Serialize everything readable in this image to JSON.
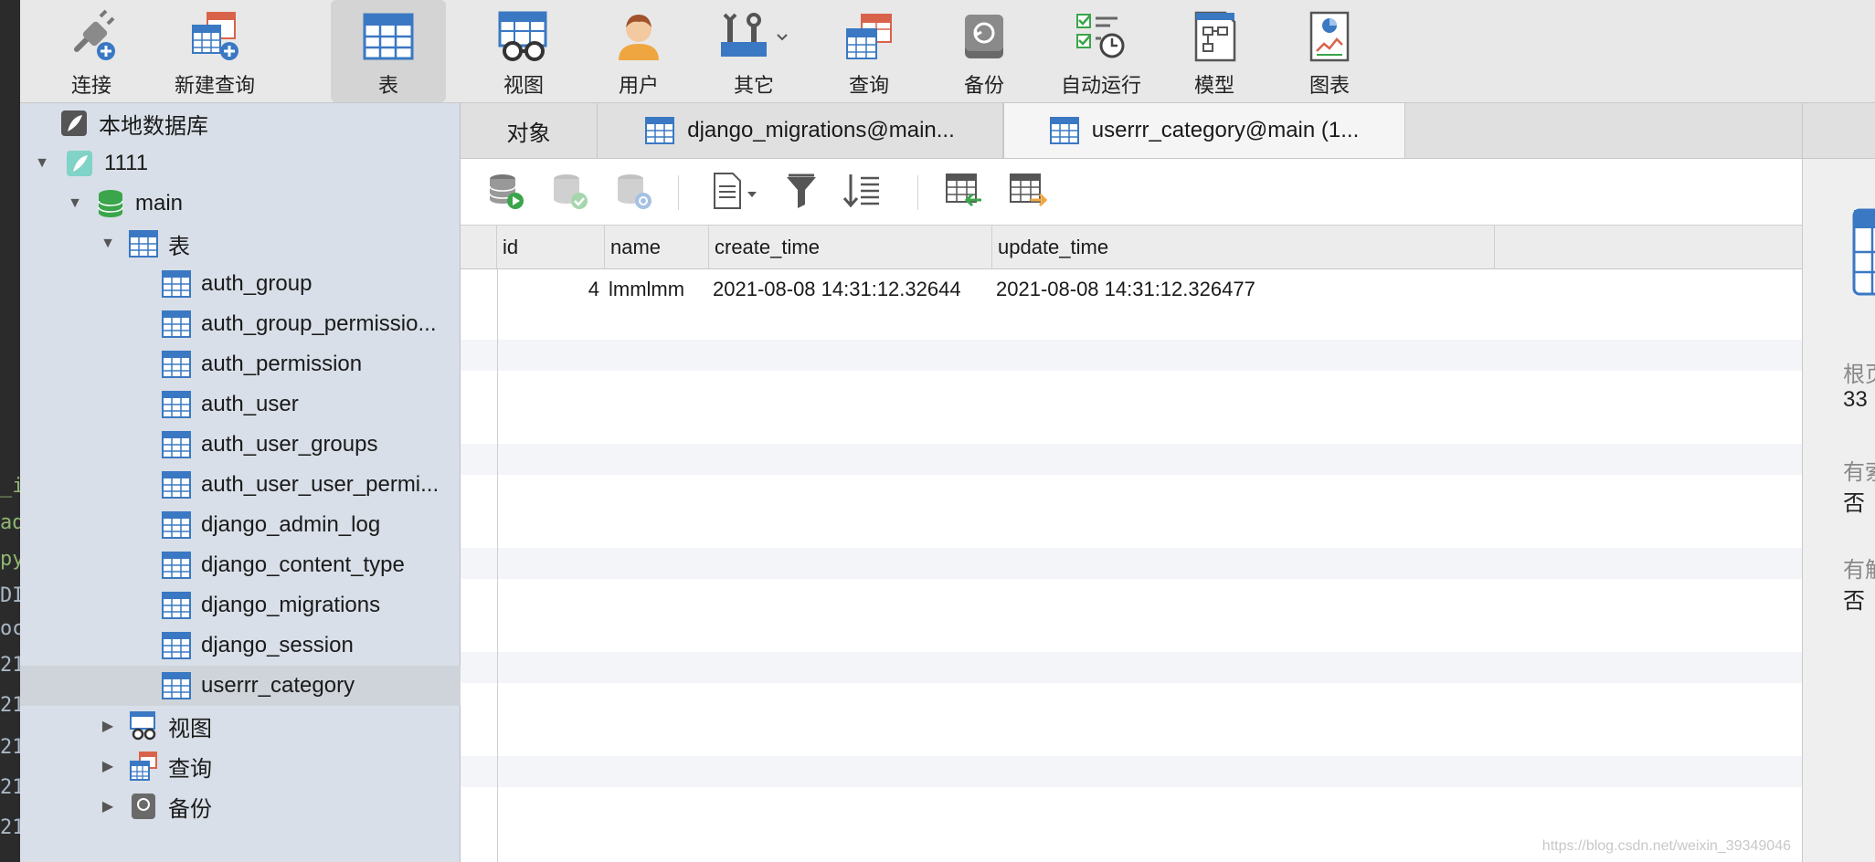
{
  "toolbar": {
    "items": [
      {
        "label": "连接",
        "icon": "plug-icon"
      },
      {
        "label": "新建查询",
        "icon": "new-query-icon"
      },
      {
        "label": "表",
        "icon": "table-icon",
        "active": true
      },
      {
        "label": "视图",
        "icon": "view-icon"
      },
      {
        "label": "用户",
        "icon": "user-icon"
      },
      {
        "label": "其它",
        "icon": "tools-icon"
      },
      {
        "label": "查询",
        "icon": "query-icon"
      },
      {
        "label": "备份",
        "icon": "backup-icon"
      },
      {
        "label": "自动运行",
        "icon": "automation-icon"
      },
      {
        "label": "模型",
        "icon": "model-icon"
      },
      {
        "label": "图表",
        "icon": "chart-icon"
      }
    ]
  },
  "sidebar": {
    "local_db": "本地数据库",
    "connection": "1111",
    "schema": "main",
    "tables_folder": "表",
    "tables": [
      "auth_group",
      "auth_group_permissio...",
      "auth_permission",
      "auth_user",
      "auth_user_groups",
      "auth_user_user_permi...",
      "django_admin_log",
      "django_content_type",
      "django_migrations",
      "django_session",
      "userrr_category"
    ],
    "selected_table": "userrr_category",
    "views_folder": "视图",
    "queries_folder": "查询",
    "backups_folder": "备份"
  },
  "tabs": [
    {
      "label": "对象"
    },
    {
      "label": "django_migrations@main..."
    },
    {
      "label": "userrr_category@main (1..."
    }
  ],
  "grid": {
    "columns": [
      "id",
      "name",
      "create_time",
      "update_time"
    ],
    "rows": [
      {
        "id": "4",
        "name": "lmmlmm",
        "create_time": "2021-08-08 14:31:12.32644",
        "update_time": "2021-08-08 14:31:12.326477"
      }
    ]
  },
  "inspector": {
    "label1": "根页",
    "value1": "33",
    "label2": "有索",
    "value2": "否",
    "label3": "有触",
    "value3": "否"
  },
  "editor_fragments": [
    "_in",
    "ad",
    "py",
    "DI",
    "oc",
    "21",
    "21",
    "21",
    "21",
    "21"
  ],
  "watermark": "https://blog.csdn.net/weixin_39349046",
  "colors": {
    "toolbar_bg": "#e8e8e8",
    "sidebar_bg": "#d8dfe8",
    "table_icon_blue": "#3a78c3",
    "db_green": "#3aa54a"
  }
}
